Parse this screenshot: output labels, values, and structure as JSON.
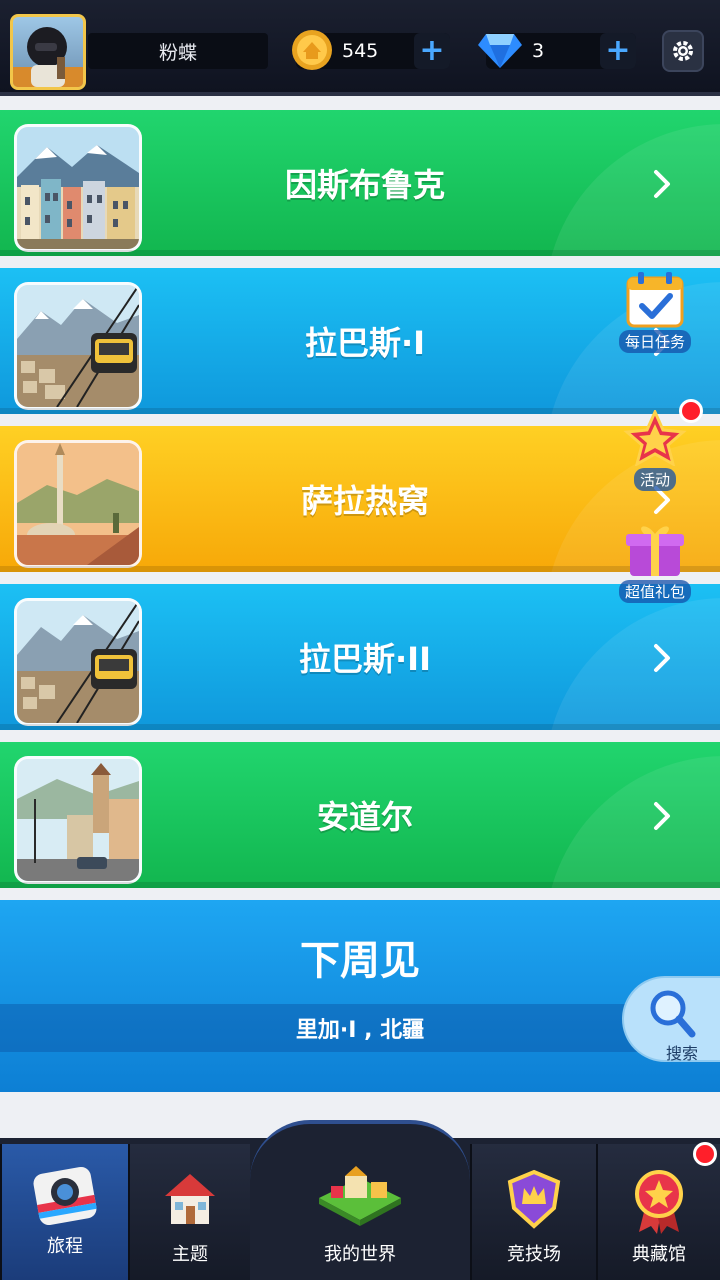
{
  "header": {
    "player_name": "粉蝶",
    "coins": "545",
    "gems": "3",
    "plus_label": "+"
  },
  "levels": [
    {
      "name": "因斯布鲁克",
      "color": "#1ccc63"
    },
    {
      "name": "拉巴斯·I",
      "color": "#17aeea"
    },
    {
      "name": "萨拉热窝",
      "color": "#fbbd14"
    },
    {
      "name": "拉巴斯·II",
      "color": "#17aeea"
    },
    {
      "name": "安道尔",
      "color": "#1ccc63"
    }
  ],
  "next_week": {
    "title": "下周见",
    "subtitle": "里加·I , 北疆"
  },
  "side_buttons": {
    "daily_tasks": "每日任务",
    "events": "活动",
    "gift_pack": "超值礼包",
    "search": "搜索"
  },
  "bottom_nav": [
    {
      "label": "旅程",
      "active": true
    },
    {
      "label": "主题",
      "active": false
    },
    {
      "label": "我的世界",
      "active": false
    },
    {
      "label": "竞技场",
      "active": false
    },
    {
      "label": "典藏馆",
      "active": false
    }
  ],
  "colors": {
    "accent_blue": "#4aa8ff",
    "notification_red": "#ff1f2a",
    "gold": "#f2c64a"
  }
}
